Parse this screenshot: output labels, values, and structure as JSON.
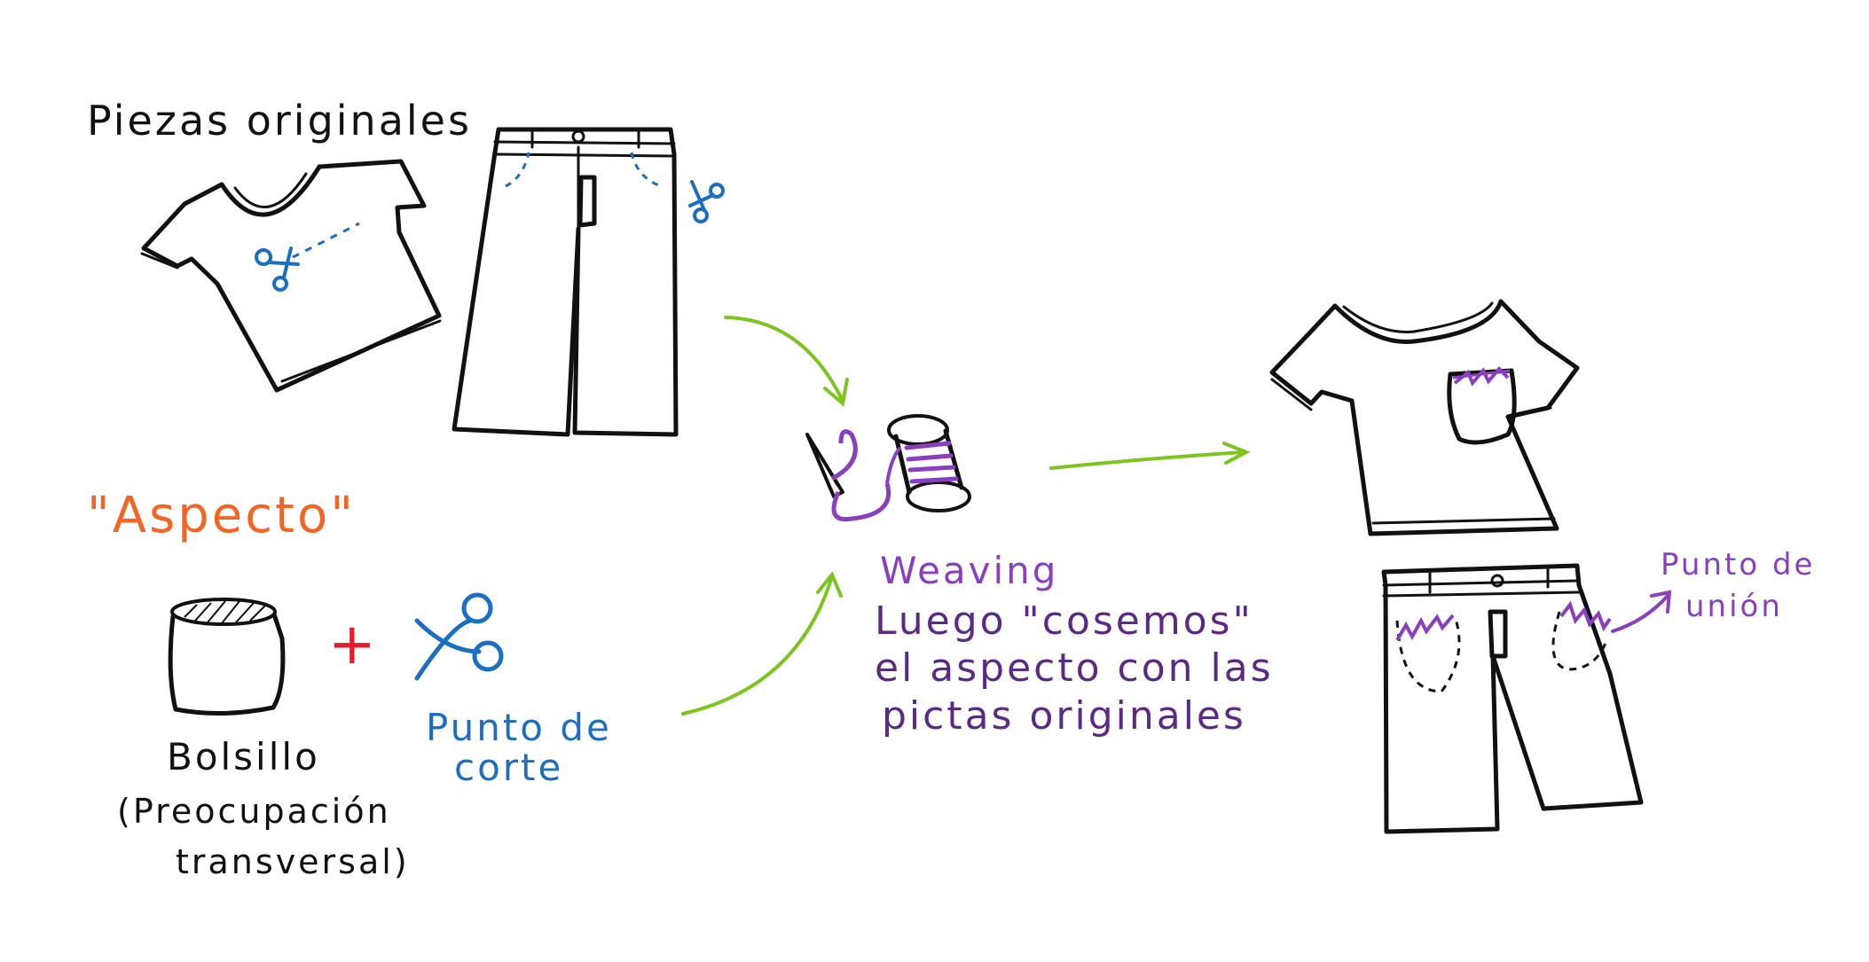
{
  "labels": {
    "piezas_originales": "Piezas originales",
    "aspecto": "\"Aspecto\"",
    "bolsillo": "Bolsillo",
    "preocupacion_line1": "(Preocupación",
    "preocupacion_line2": "transversal)",
    "punto_corte_line1": "Punto de",
    "punto_corte_line2": "corte",
    "plus": "+",
    "weaving": "Weaving",
    "weaving_line2": "Luego \"cosemos\"",
    "weaving_line3": "el aspecto con las",
    "weaving_line4": "pictas originales",
    "punto_union_line1": "Punto de",
    "punto_union_line2": "unión"
  },
  "colors": {
    "ink": "#111111",
    "orange": "#f26522",
    "red": "#e8192c",
    "blue": "#1a6fc4",
    "purple": "#8b3fbf",
    "green": "#7cc520"
  }
}
